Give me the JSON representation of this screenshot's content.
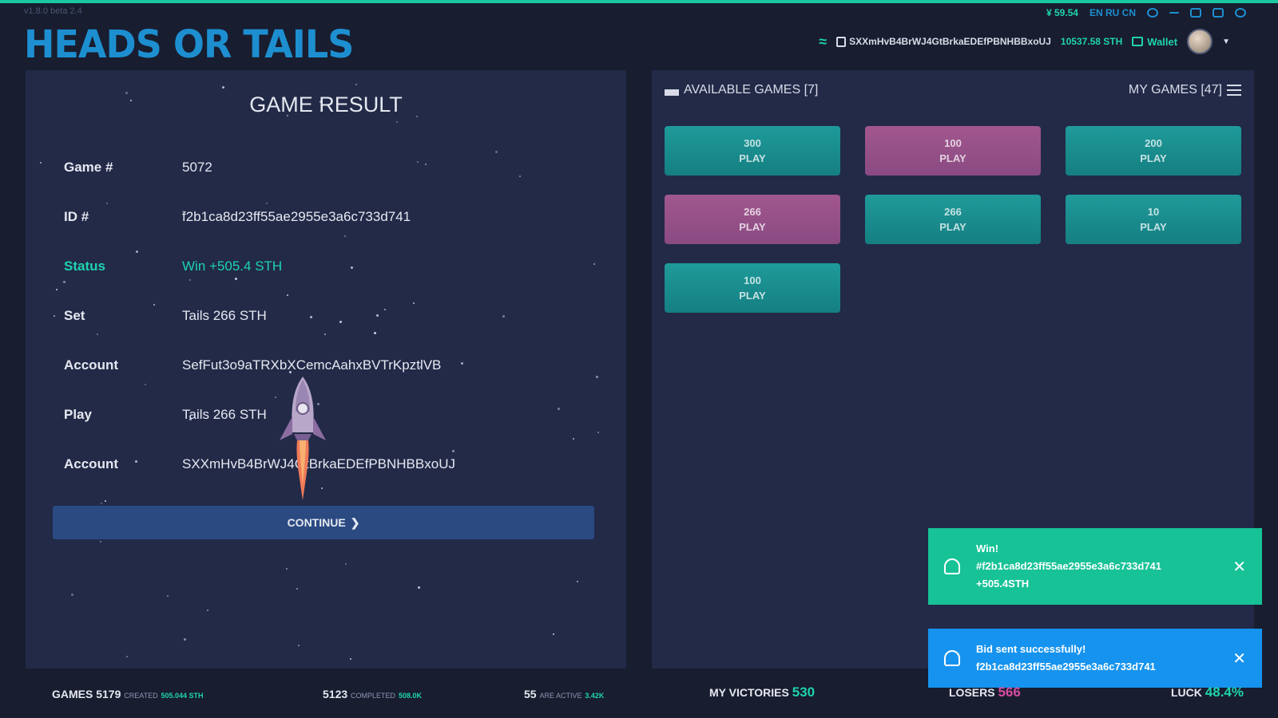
{
  "app": {
    "version": "v1.8.0 beta 2.4",
    "logo": "HEADS OR TAILS"
  },
  "sysbar": {
    "price": "¥ 59.54",
    "languages": "EN RU CN"
  },
  "header": {
    "address": "SXXmHvB4BrWJ4GtBrkaEDEfPBNHBBxoUJ",
    "balance": "10537.58 STH",
    "wallet_label": "Wallet"
  },
  "result": {
    "title": "GAME RESULT",
    "rows": [
      {
        "label": "Game #",
        "value": "5072"
      },
      {
        "label": "ID #",
        "value": "f2b1ca8d23ff55ae2955e3a6c733d741"
      },
      {
        "label": "Status",
        "value": "Win +505.4 STH"
      },
      {
        "label": "Set",
        "value": "Tails 266 STH"
      },
      {
        "label": "Account",
        "value": "SefFut3o9aTRXbXCemcAahxBVTrKpztlVB"
      },
      {
        "label": "Play",
        "value": "Tails 266 STH"
      },
      {
        "label": "Account",
        "value": "SXXmHvB4BrWJ4GtBrkaEDEfPBNHBBxoUJ"
      }
    ],
    "continue_label": "CONTINUE"
  },
  "games": {
    "available_label": "AVAILABLE GAMES [7]",
    "my_games_label": "MY GAMES [47]",
    "buttons": [
      {
        "amount": "300",
        "action": "PLAY",
        "color": "teal"
      },
      {
        "amount": "100",
        "action": "PLAY",
        "color": "pink"
      },
      {
        "amount": "200",
        "action": "PLAY",
        "color": "teal"
      },
      {
        "amount": "266",
        "action": "PLAY",
        "color": "pink"
      },
      {
        "amount": "266",
        "action": "PLAY",
        "color": "teal"
      },
      {
        "amount": "10",
        "action": "PLAY",
        "color": "teal"
      },
      {
        "amount": "100",
        "action": "PLAY",
        "color": "teal"
      }
    ]
  },
  "toasts": {
    "win": {
      "line1": "Win!",
      "line2": "#f2b1ca8d23ff55ae2955e3a6c733d741",
      "line3": "+505.4STH"
    },
    "bid": {
      "line1": "Bid sent successfully!",
      "line2": "f2b1ca8d23ff55ae2955e3a6c733d741"
    }
  },
  "footer": {
    "games_count": "GAMES 5179",
    "created_label": "CREATED",
    "created_value": "505.044 STH",
    "completed_count": "5123",
    "completed_label": "COMPLETED",
    "completed_value": "508.0K",
    "active_count": "55",
    "active_label": "ARE ACTIVE",
    "active_value": "3.42K",
    "victories_label": "MY VICTORIES",
    "victories_value": "530",
    "losers_label": "LOSERS",
    "losers_value": "566",
    "luck_label": "LUCK",
    "luck_value": "48.4%"
  },
  "colors": {
    "accent": "#1fd3ae",
    "brand": "#1d8fd0",
    "panel": "#222a48",
    "pink": "#a1578e",
    "teal": "#1f9a9a"
  }
}
